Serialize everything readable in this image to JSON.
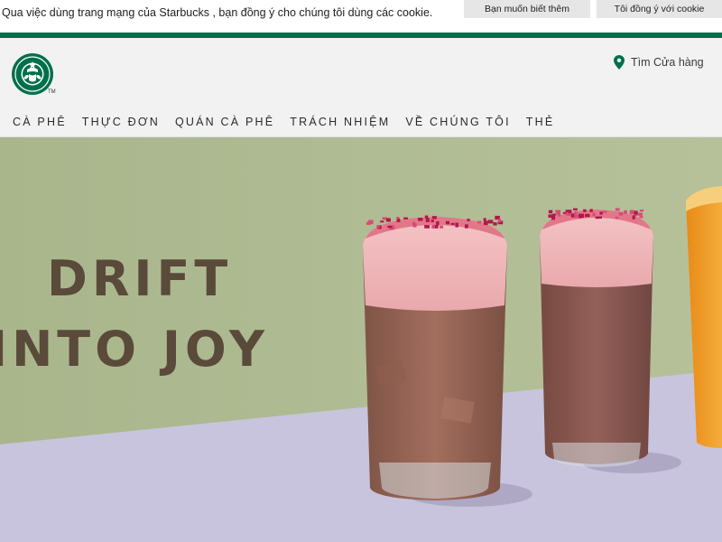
{
  "cookie_banner": {
    "message": "Qua việc dùng trang mạng của Starbucks , bạn đồng ý cho chúng tôi dùng các cookie.",
    "learn_more_label": "Bạn muốn biết thêm",
    "agree_label": "Tôi đồng ý với cookie"
  },
  "header": {
    "logo_icon": "starbucks-siren-logo",
    "trademark": "TM",
    "store_finder": {
      "icon": "map-pin-icon",
      "label": "Tìm Cửa hàng"
    },
    "nav": [
      {
        "label": "CÀ PHÊ"
      },
      {
        "label": "THỰC ĐƠN"
      },
      {
        "label": "QUÁN CÀ PHÊ"
      },
      {
        "label": "TRÁCH NHIỆM"
      },
      {
        "label": "VỀ CHÚNG TÔI"
      },
      {
        "label": "THẺ"
      }
    ]
  },
  "hero": {
    "headline_line1": "DRIFT",
    "headline_line2": "INTO JOY"
  },
  "colors": {
    "brand_green": "#00704a",
    "hero_green": "#a8b58b",
    "hero_lavender": "#c9c4dd",
    "headline_brown": "#5a4a3a"
  }
}
